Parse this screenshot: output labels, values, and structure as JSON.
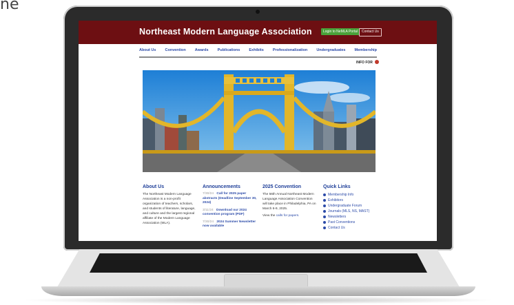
{
  "corner": "ne",
  "site": {
    "title": "Northeast Modern Language Association",
    "login_label": "Login to NeMLA Portal",
    "contact_label": "Contact Us"
  },
  "nav": [
    "About Us",
    "Convention",
    "Awards",
    "Publications",
    "Exhibits",
    "Professionalization",
    "Undergraduates",
    "Membership"
  ],
  "info_for": "INFO FOR",
  "about": {
    "heading": "About Us",
    "text": "The Northeast Modern Language Association is a non-profit organization of teachers, scholars, and students of literature, language, and culture and the largest regional affiliate of the Modern Language Association (MLA)."
  },
  "announcements": {
    "heading": "Announcements",
    "items": [
      {
        "date": "7/30/24",
        "text": "Call for 2025 paper abstracts (Deadline September 30, 2024)"
      },
      {
        "date": "3/11/24",
        "text": "Download our 2024 convention program (PDF)"
      },
      {
        "date": "7/30/24",
        "text": "2024 Summer Newsletter now available"
      }
    ]
  },
  "convention": {
    "heading": "2025 Convention",
    "text": "The 56th Annual Northeast Modern Language Association Convention will take place in Philadelphia, PA on March 6-9, 2025.",
    "view_prefix": "View the",
    "view_link": "calls for papers."
  },
  "quicklinks": {
    "heading": "Quick Links",
    "items": [
      "Membership Info",
      "Exhibitors",
      "Undergraduate Forum",
      "Journals (MLS, NS, MAST)",
      "Newsletters",
      "Past Conventions",
      "Contact Us"
    ]
  },
  "colors": {
    "header": "#6d0f12",
    "link": "#2b4aa8",
    "login": "#4aa23a"
  }
}
